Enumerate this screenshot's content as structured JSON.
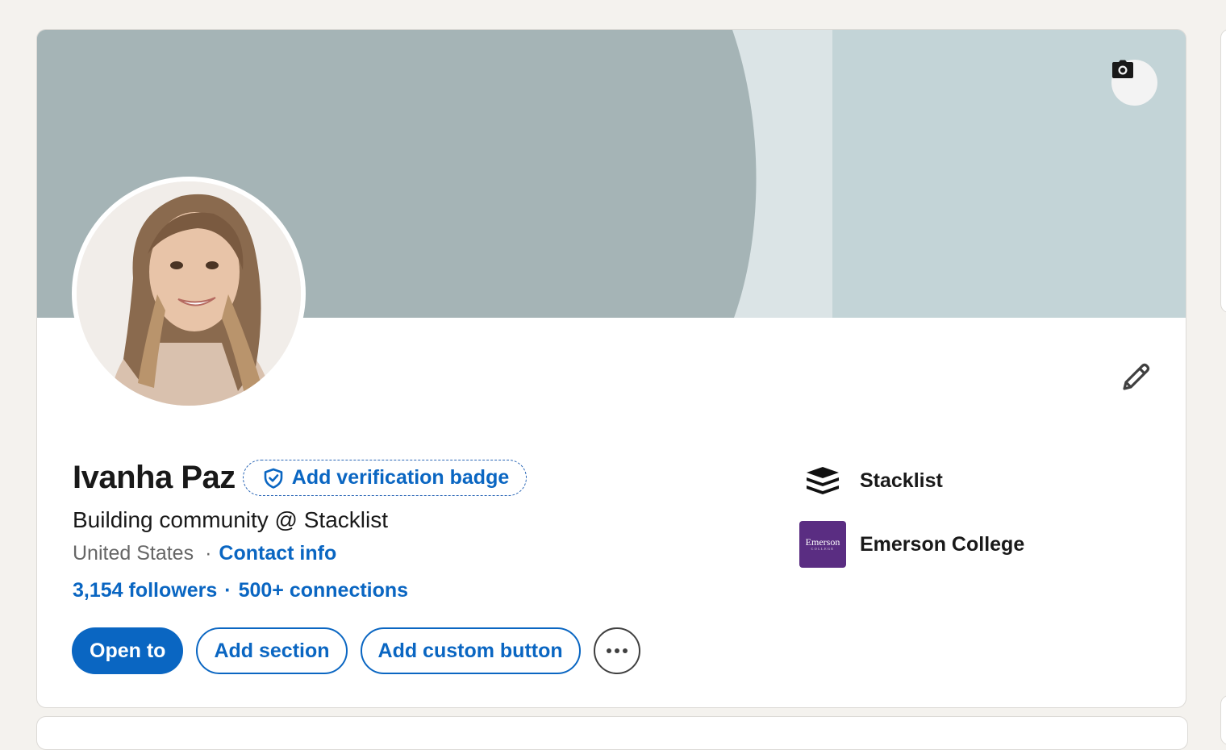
{
  "profile": {
    "name": "Ivanha Paz",
    "verification_badge_label": "Add verification badge",
    "headline": "Building community @ Stacklist",
    "location": "United States",
    "location_separator": "·",
    "contact_info_label": "Contact info",
    "followers_label": "3,154 followers",
    "network_separator": "·",
    "connections_label": "500+ connections"
  },
  "actions": {
    "open_to_label": "Open to",
    "add_section_label": "Add section",
    "add_custom_button_label": "Add custom button",
    "more_label": "···"
  },
  "organizations": [
    {
      "name": "Stacklist",
      "icon": "stacklist-logo"
    },
    {
      "name": "Emerson College",
      "icon": "emerson-college-logo",
      "logo_text": "Emerson",
      "logo_subtext": "COLLEGE"
    }
  ],
  "icons": {
    "camera": "camera-icon",
    "edit": "pencil-icon",
    "shield": "shield-check-icon"
  },
  "colors": {
    "accent": "#0a66c2",
    "banner_light": "#c3d4d7",
    "banner_dark": "#a5b4b6",
    "emerson_purple": "#5a2d82"
  }
}
